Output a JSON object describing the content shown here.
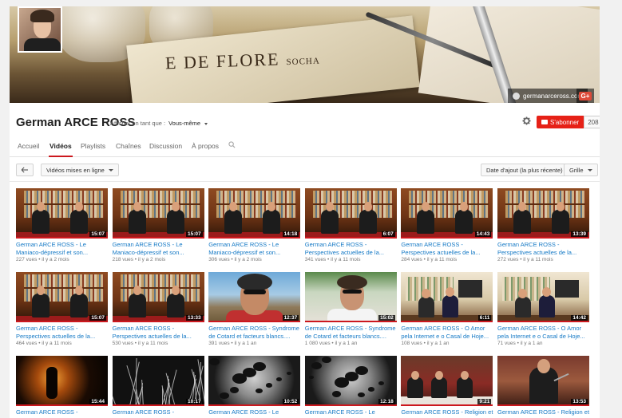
{
  "banner": {
    "menu_text": "E DE FLORE",
    "menu_small": "SOCHA",
    "site_link": "germanarceross.com",
    "gplus": "G+"
  },
  "header": {
    "channel_title": "German ARCE ROSS",
    "view_as_label": "Afficher en tant que :",
    "view_as_value": "Vous-même",
    "subscribe_label": "S'abonner",
    "subscriber_count": "208"
  },
  "tabs": [
    "Accueil",
    "Vidéos",
    "Playlists",
    "Chaînes",
    "Discussion",
    "À propos"
  ],
  "active_tab": "Vidéos",
  "toolbar": {
    "filter": "Vidéos mises en ligne",
    "sort": "Date d'ajout (la plus récente)",
    "view": "Grille"
  },
  "colors": {
    "accent": "#cc181e",
    "link": "#167ac6",
    "subscribe": "#e62117"
  },
  "videos": [
    {
      "title": "German ARCE ROSS - Le Maniaco-dépressif et son...",
      "views": "227 vues",
      "age": "il y a 2 mois",
      "duration": "15:07",
      "thumb": "lib"
    },
    {
      "title": "German ARCE ROSS - Le Maniaco-dépressif et son...",
      "views": "218 vues",
      "age": "il y a 2 mois",
      "duration": "15:07",
      "thumb": "lib"
    },
    {
      "title": "German ARCE ROSS - Le Maniaco-dépressif et son...",
      "views": "306 vues",
      "age": "il y a 2 mois",
      "duration": "14:18",
      "thumb": "lib"
    },
    {
      "title": "German ARCE ROSS - Perspectives actuelles de la...",
      "views": "341 vues",
      "age": "il y a 11 mois",
      "duration": "6:07",
      "thumb": "lib"
    },
    {
      "title": "German ARCE ROSS - Perspectives actuelles de la...",
      "views": "284 vues",
      "age": "il y a 11 mois",
      "duration": "14:43",
      "thumb": "lib"
    },
    {
      "title": "German ARCE ROSS - Perspectives actuelles de la...",
      "views": "272 vues",
      "age": "il y a 11 mois",
      "duration": "13:39",
      "thumb": "lib"
    },
    {
      "title": "German ARCE ROSS - Perspectives actuelles de la...",
      "views": "464 vues",
      "age": "il y a 11 mois",
      "duration": "15:07",
      "thumb": "lib"
    },
    {
      "title": "German ARCE ROSS - Perspectives actuelles de la...",
      "views": "530 vues",
      "age": "il y a 11 mois",
      "duration": "13:33",
      "thumb": "lib"
    },
    {
      "title": "German ARCE ROSS - Syndrome de Cotard et facteurs blancs....",
      "views": "391 vues",
      "age": "il y a 1 an",
      "duration": "12:37",
      "thumb": "sky"
    },
    {
      "title": "German ARCE ROSS - Syndrome de Cotard et facteurs blancs....",
      "views": "1 080 vues",
      "age": "il y a 1 an",
      "duration": "15:02",
      "thumb": "green"
    },
    {
      "title": "German ARCE ROSS - O Amor pela Internet e o Casal de Hoje...",
      "views": "108 vues",
      "age": "il y a 1 an",
      "duration": "6:11",
      "thumb": "conf"
    },
    {
      "title": "German ARCE ROSS - O Amor pela Internet e o Casal de Hoje...",
      "views": "71 vues",
      "age": "il y a 1 an",
      "duration": "14:42",
      "thumb": "conf"
    },
    {
      "title": "German ARCE ROSS -",
      "views": "",
      "age": "",
      "duration": "15:44",
      "thumb": "dark"
    },
    {
      "title": "German ARCE ROSS -",
      "views": "",
      "age": "",
      "duration": "10:17",
      "thumb": "tree"
    },
    {
      "title": "German ARCE ROSS - Le",
      "views": "",
      "age": "",
      "duration": "10:52",
      "thumb": "ink"
    },
    {
      "title": "German ARCE ROSS - Le",
      "views": "",
      "age": "",
      "duration": "12:18",
      "thumb": "ink"
    },
    {
      "title": "German ARCE ROSS - Religion et",
      "views": "",
      "age": "",
      "duration": "9:21",
      "thumb": "panel"
    },
    {
      "title": "German ARCE ROSS - Religion et",
      "views": "",
      "age": "",
      "duration": "13:53",
      "thumb": "speaker"
    }
  ]
}
